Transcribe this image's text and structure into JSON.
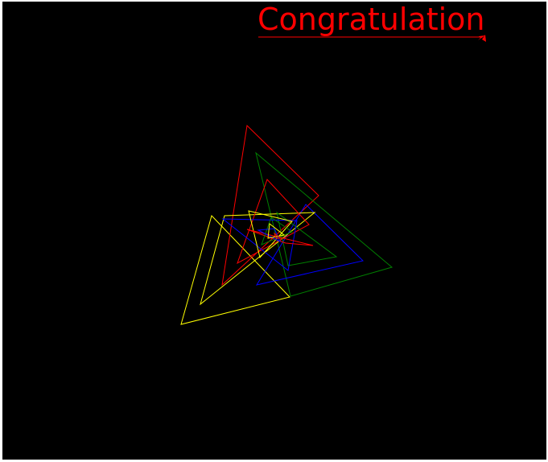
{
  "canvas": {
    "background": "#000000",
    "caption": "Congratulation",
    "caption_color": "#ff0000",
    "turtle_color": "#ff0000",
    "turtle_icon": "turtle-arrow-cursor"
  },
  "spiral": {
    "colors": [
      "#ffff00",
      "#ff0000",
      "#008000",
      "#0000ff"
    ],
    "color_names": [
      "yellow",
      "red",
      "green",
      "blue"
    ]
  }
}
